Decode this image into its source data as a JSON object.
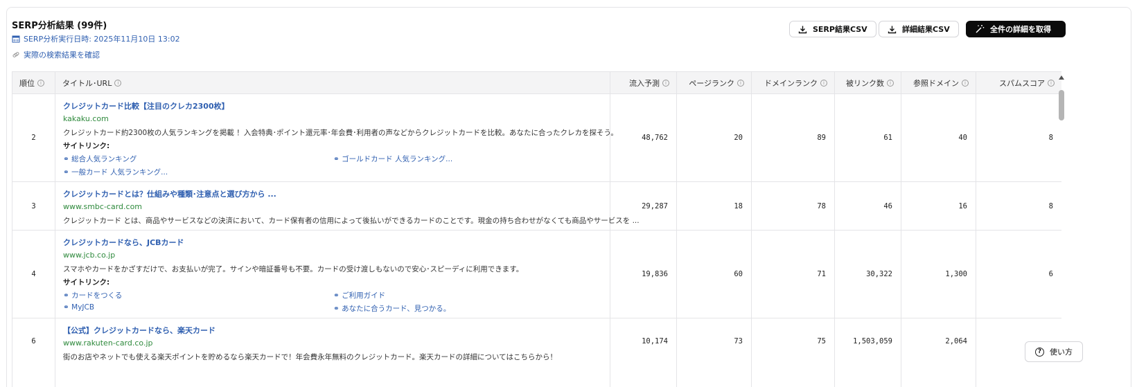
{
  "header": {
    "title": "SERP分析結果 (99件)",
    "run_date": "SERP分析実行日時: 2025年11月10日 13:02",
    "check_link": "実際の検索結果を確認"
  },
  "buttons": {
    "serp_csv": "SERP結果CSV",
    "detail_csv": "詳細結果CSV",
    "fetch_all": "全件の詳細を取得"
  },
  "columns": [
    "順位",
    "タイトル･URL",
    "流入予測",
    "ページランク",
    "ドメインランク",
    "被リンク数",
    "参照ドメイン",
    "スパムスコア"
  ],
  "sitelink_label": "サイトリンク:",
  "rows": [
    {
      "rank": "2",
      "title": "クレジットカード比較【注目のクレカ2300枚】",
      "domain": "kakaku.com",
      "desc": "クレジットカード約2300枚の人気ランキングを掲載 ！入会特典･ポイント還元率･年会費･利用者の声などからクレジットカードを比較。あなたに合ったクレカを探そう。",
      "sitelinks": [
        "総合人気ランキング",
        "ゴールドカード 人気ランキング...",
        "一般カード 人気ランキング..."
      ],
      "traffic": "48,762",
      "page_rank": "20",
      "domain_rank": "89",
      "backlinks": "61",
      "ref_domains": "40",
      "spam": "8"
    },
    {
      "rank": "3",
      "title": "クレジットカードとは？仕組みや種類･注意点と選び方から ...",
      "domain": "www.smbc-card.com",
      "desc": "クレジットカード とは、商品やサービスなどの決済において、カード保有者の信用によって後払いができるカードのことです。現金の持ち合わせがなくても商品やサービスを ...",
      "sitelinks": [],
      "traffic": "29,287",
      "page_rank": "18",
      "domain_rank": "78",
      "backlinks": "46",
      "ref_domains": "16",
      "spam": "8"
    },
    {
      "rank": "4",
      "title": "クレジットカードなら、JCBカード",
      "domain": "www.jcb.co.jp",
      "desc": "スマホやカードをかざすだけで、お支払いが完了。サインや暗証番号も不要。カードの受け渡しもないので安心･スピーディに利用できます。",
      "sitelinks": [
        "カードをつくる",
        "ご利用ガイド",
        "MyJCB",
        "あなたに合うカード、見つかる。"
      ],
      "traffic": "19,836",
      "page_rank": "60",
      "domain_rank": "71",
      "backlinks": "30,322",
      "ref_domains": "1,300",
      "spam": "6"
    },
    {
      "rank": "6",
      "title": "【公式】クレジットカードなら、楽天カード",
      "domain": "www.rakuten-card.co.jp",
      "desc": "街のお店やネットでも使える楽天ポイントを貯めるなら楽天カードで！年会費永年無料のクレジットカード。楽天カードの詳細についてはこちらから！",
      "sitelinks": [],
      "traffic": "10,174",
      "page_rank": "73",
      "domain_rank": "75",
      "backlinks": "1,503,059",
      "ref_domains": "2,064",
      "spam": ""
    }
  ],
  "help_label": "使い方"
}
